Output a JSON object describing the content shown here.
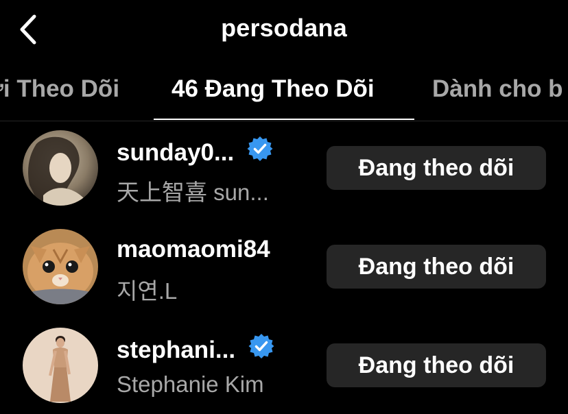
{
  "header": {
    "title": "persodana"
  },
  "tabs": [
    {
      "label": "ời Theo Dõi"
    },
    {
      "label": "46 Đang Theo Dõi"
    },
    {
      "label": "Dành cho b"
    }
  ],
  "accounts": [
    {
      "username": "sunday0...",
      "full_name": "天上智喜 sun...",
      "verified": true,
      "button_label": "Đang theo dõi"
    },
    {
      "username": "maomaomi84",
      "full_name": "지연.L",
      "verified": false,
      "button_label": "Đang theo dõi"
    },
    {
      "username": "stephani...",
      "full_name": "Stephanie Kim",
      "verified": true,
      "button_label": "Đang theo dõi"
    }
  ],
  "colors": {
    "background": "#000000",
    "secondary_text": "#a8a8a8",
    "button_bg": "#262626",
    "verified_badge": "#3897f0"
  },
  "icons": {
    "back": "chevron-left-icon",
    "verified": "verified-badge-icon"
  }
}
